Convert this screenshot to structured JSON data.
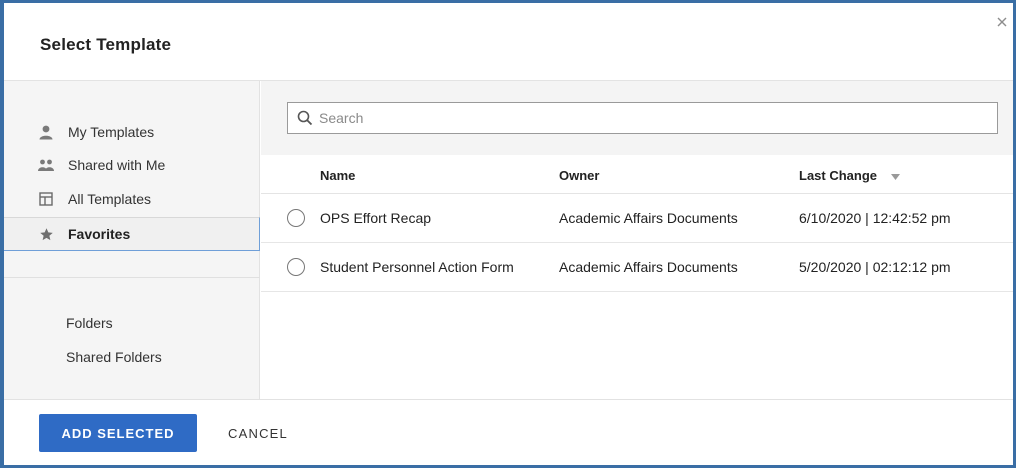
{
  "dialog": {
    "title": "Select Template",
    "close_icon": "close-icon"
  },
  "sidebar": {
    "items": [
      {
        "label": "My Templates",
        "icon": "person-icon"
      },
      {
        "label": "Shared with Me",
        "icon": "people-icon"
      },
      {
        "label": "All Templates",
        "icon": "template-layout-icon"
      },
      {
        "label": "Favorites",
        "icon": "star-icon",
        "active": true
      }
    ],
    "folders": [
      {
        "label": "Folders"
      },
      {
        "label": "Shared Folders"
      }
    ]
  },
  "search": {
    "placeholder": "Search",
    "value": "",
    "icon": "search-icon"
  },
  "table": {
    "columns": {
      "name": "Name",
      "owner": "Owner",
      "last_change": "Last Change"
    },
    "sort_icon": "sort-desc-caret-icon",
    "rows": [
      {
        "name": "OPS Effort Recap",
        "owner": "Academic Affairs Documents",
        "last_change": "6/10/2020 | 12:42:52 pm"
      },
      {
        "name": "Student Personnel Action Form",
        "owner": "Academic Affairs Documents",
        "last_change": "5/20/2020 | 02:12:12 pm"
      }
    ]
  },
  "footer": {
    "add_label": "ADD SELECTED",
    "cancel_label": "CANCEL"
  },
  "colors": {
    "accent": "#2f6bc5",
    "frame": "#3a6ea5"
  }
}
